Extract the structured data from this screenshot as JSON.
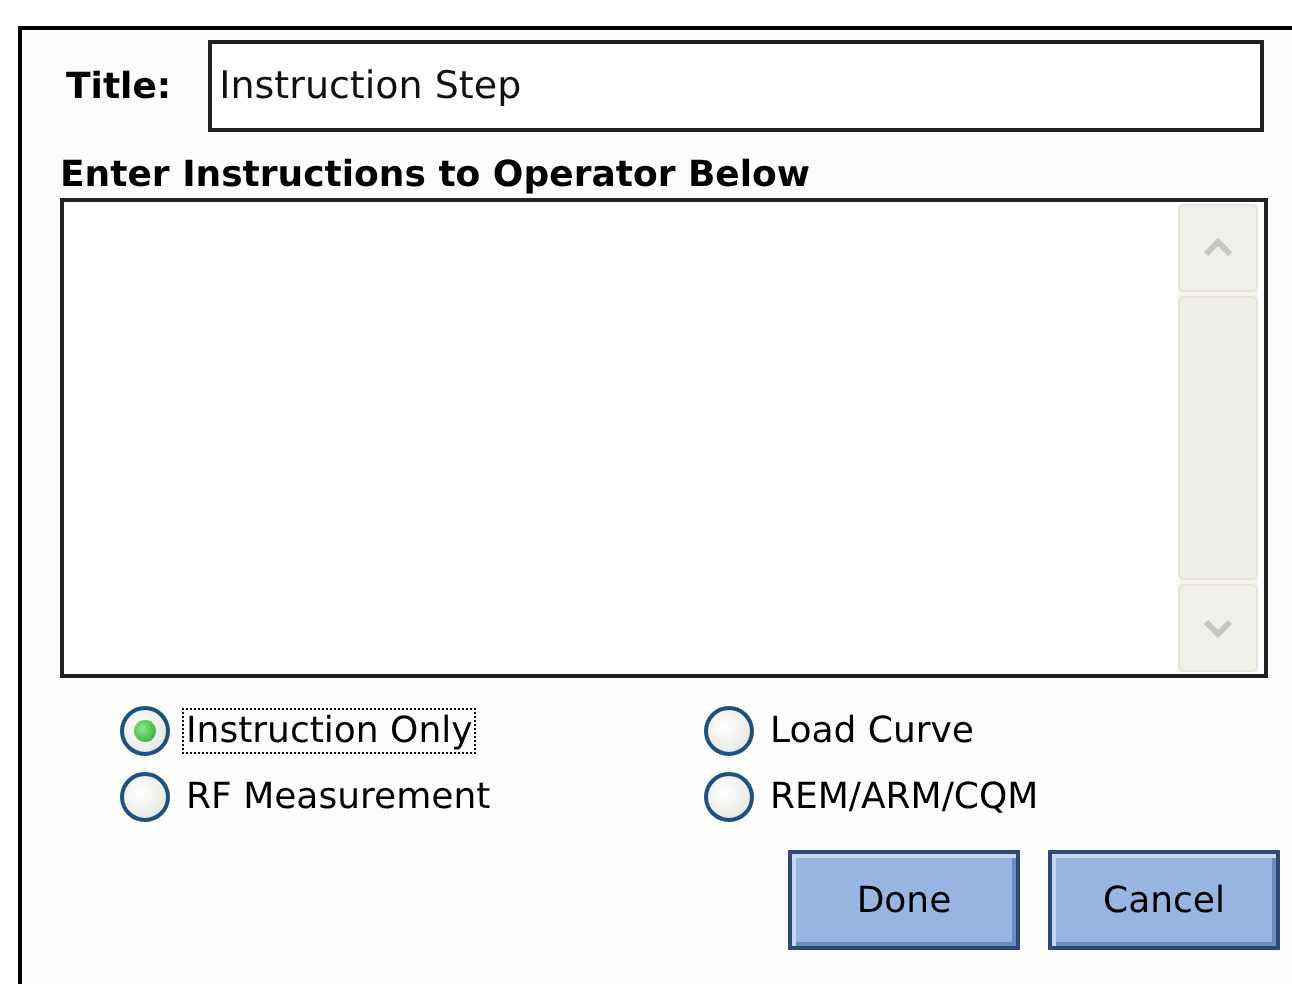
{
  "title_field": {
    "label": "Title:",
    "value": "Instruction Step"
  },
  "instructions": {
    "label": "Enter Instructions to Operator Below"
  },
  "step_types": [
    {
      "label": "Instruction Only",
      "selected": true,
      "focused": true
    },
    {
      "label": "Load Curve",
      "selected": false,
      "focused": false
    },
    {
      "label": "RF Measurement",
      "selected": false,
      "focused": false
    },
    {
      "label": "REM/ARM/CQM",
      "selected": false,
      "focused": false
    }
  ],
  "buttons": [
    {
      "label": "Done"
    },
    {
      "label": "Cancel"
    }
  ]
}
